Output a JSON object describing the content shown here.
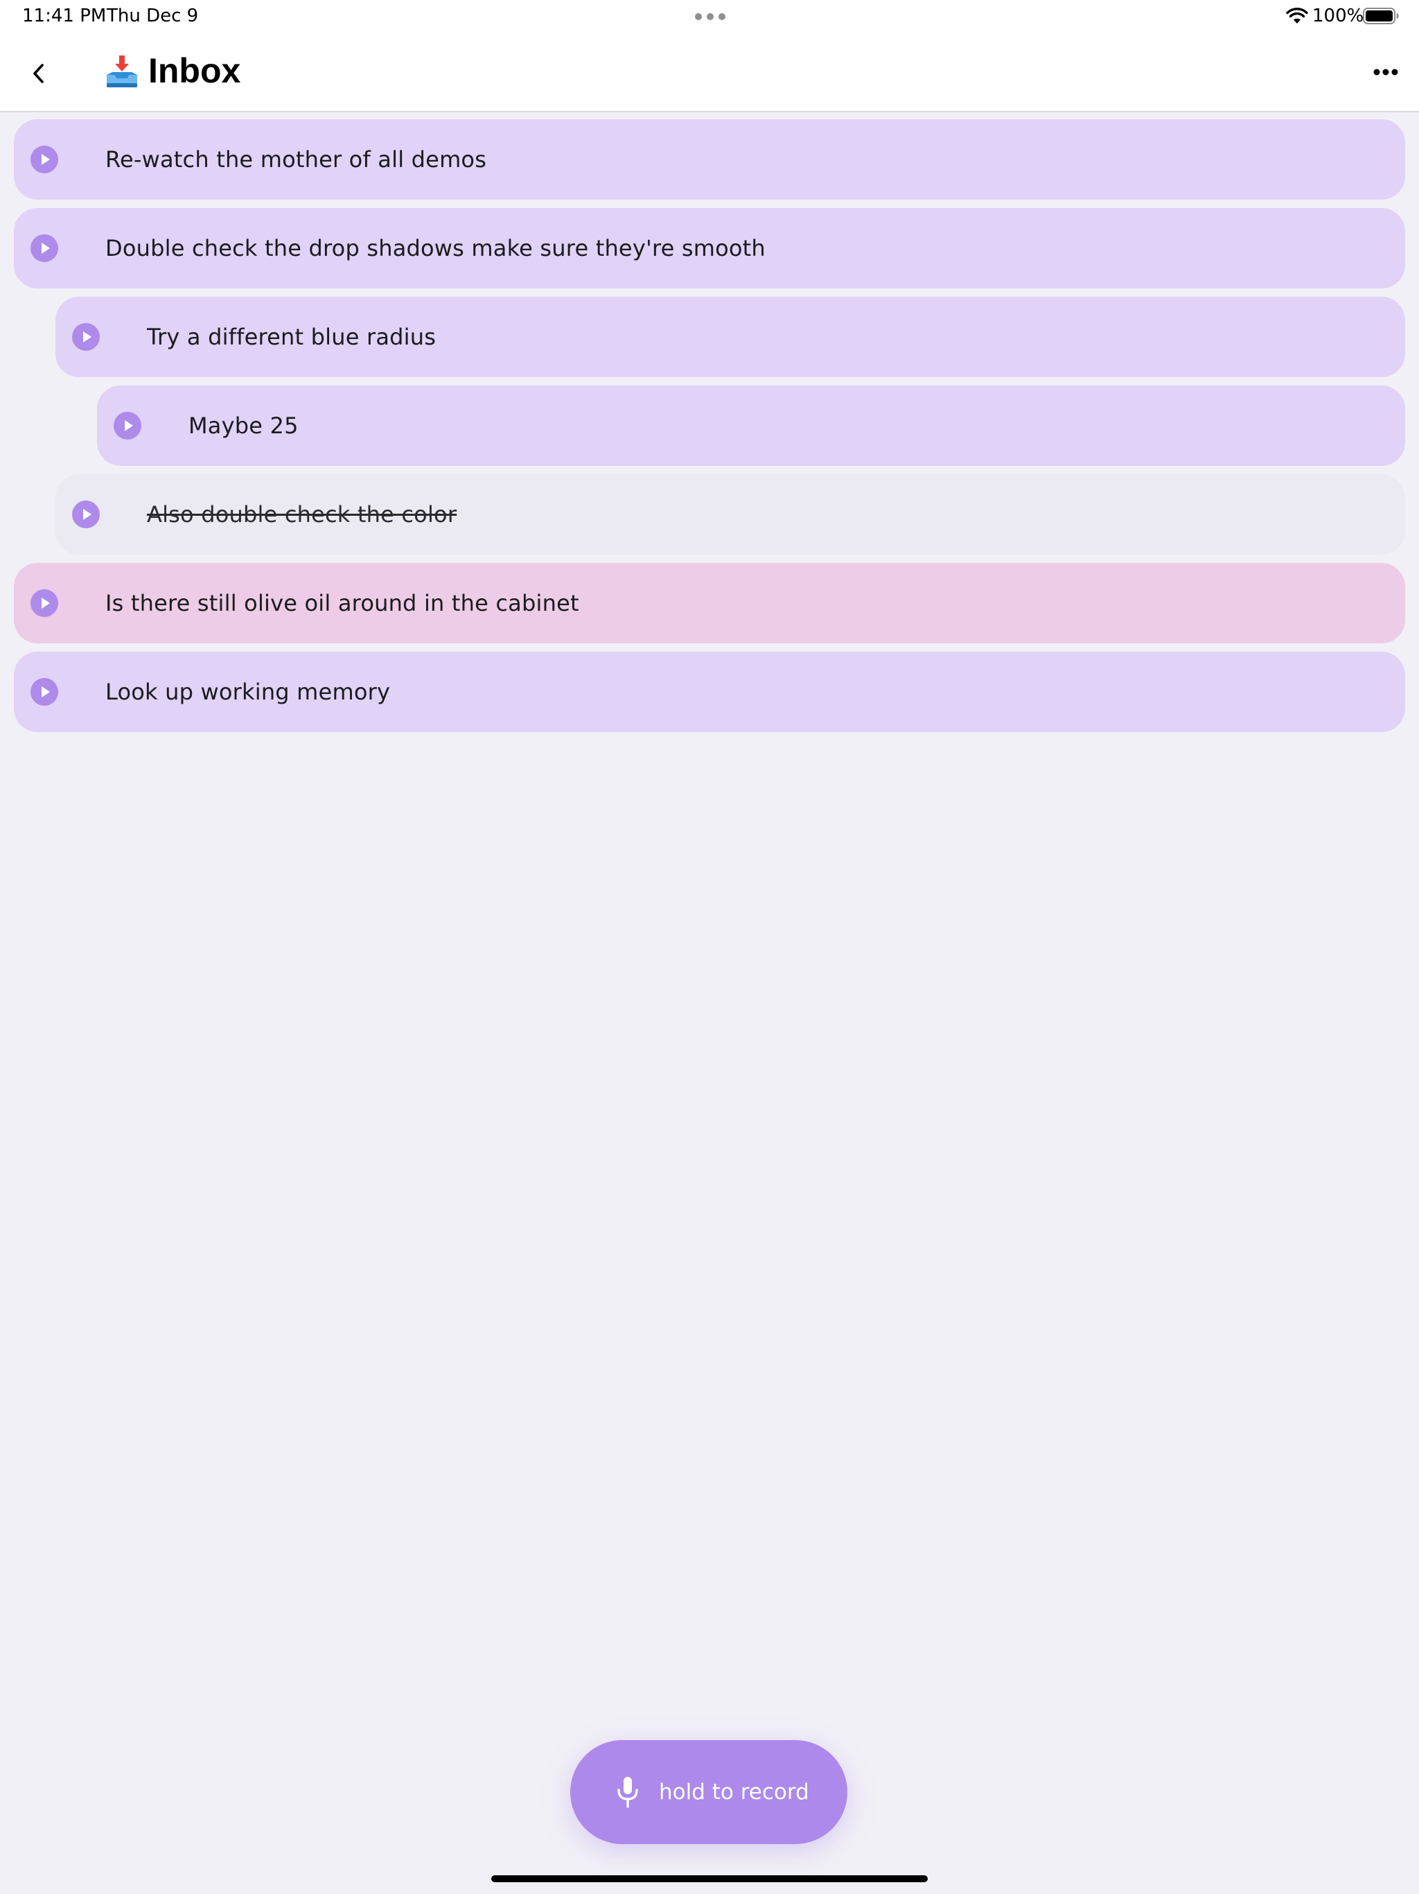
{
  "status_bar": {
    "time": "11:41 PM",
    "date": "Thu Dec 9",
    "battery": "100%"
  },
  "header": {
    "title": "Inbox",
    "title_emoji": "inbox-tray-icon"
  },
  "items": [
    {
      "text": "Re-watch the mother of all demos",
      "level": 0,
      "color": "#e1d2f7",
      "completed": false
    },
    {
      "text": "Double check the drop shadows make sure they're smooth",
      "level": 0,
      "color": "#e1d2f7",
      "completed": false
    },
    {
      "text": "Try a different blue radius",
      "level": 1,
      "color": "#e1d2f7",
      "completed": false
    },
    {
      "text": "Maybe 25",
      "level": 2,
      "color": "#e1d2f7",
      "completed": false
    },
    {
      "text": "Also double check the color",
      "level": 1,
      "color": "#ebe9f1",
      "completed": true
    },
    {
      "text": "Is there still olive oil around in the cabinet",
      "level": 0,
      "color": "#eccce6",
      "completed": false
    },
    {
      "text": "Look up working memory",
      "level": 0,
      "color": "#e1d2f7",
      "completed": false
    }
  ],
  "record_button": {
    "label": "hold to record",
    "icon": "microphone-icon",
    "color": "#ac89ea"
  },
  "colors": {
    "background": "#f1f0f6",
    "accent": "#ae8aeb"
  }
}
